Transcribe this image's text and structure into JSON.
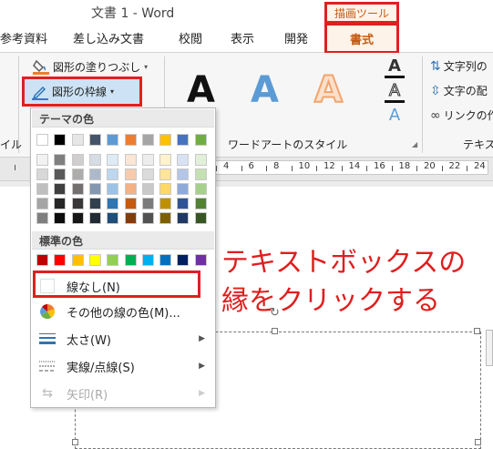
{
  "window": {
    "title": "文書 1 - Word"
  },
  "context_tab": {
    "label": "描画ツール"
  },
  "tabs": [
    {
      "label": "参考資料"
    },
    {
      "label": "差し込み文書"
    },
    {
      "label": "校閲"
    },
    {
      "label": "表示"
    },
    {
      "label": "開発"
    },
    {
      "label": "書式"
    }
  ],
  "ribbon": {
    "shape_fill": "図形の塗りつぶし",
    "shape_outline": "図形の枠線",
    "left_group_partial": "イル",
    "wordart_styles": "ワードアートのスタイル",
    "text_direction": "文字列の",
    "text_align": "文字の配",
    "create_link": "リンクの作",
    "text_group_partial": "テキス",
    "wordart_sample": "A"
  },
  "ruler": {
    "numbers": [
      "4",
      "6",
      "8",
      "10",
      "12",
      "14",
      "16",
      "18",
      "20",
      "22",
      "24"
    ]
  },
  "menu": {
    "theme_colors_label": "テーマの色",
    "standard_colors_label": "標準の色",
    "no_outline": "線なし(N)",
    "more_colors": "その他の線の色(M)...",
    "weight": "太さ(W)",
    "dashes": "実線/点線(S)",
    "arrows": "矢印(R)",
    "theme_top": [
      "#ffffff",
      "#000000",
      "#e7e6e6",
      "#44546a",
      "#5b9bd5",
      "#ed7d31",
      "#a5a5a5",
      "#ffc000",
      "#4472c4",
      "#70ad47"
    ],
    "theme_shades": [
      [
        "#f2f2f2",
        "#7f7f7f",
        "#d0cece",
        "#d6dce4",
        "#deebf6",
        "#fbe5d5",
        "#ededed",
        "#fff2cc",
        "#d9e2f3",
        "#e2efd9"
      ],
      [
        "#d8d8d8",
        "#595959",
        "#aeabab",
        "#adb9ca",
        "#bdd7ee",
        "#f7cbac",
        "#dbdbdb",
        "#fee599",
        "#b4c6e7",
        "#c5e0b3"
      ],
      [
        "#bfbfbf",
        "#3f3f3f",
        "#757070",
        "#8497b0",
        "#9cc3e5",
        "#f4b183",
        "#c9c9c9",
        "#ffd965",
        "#8eaadb",
        "#a8d08d"
      ],
      [
        "#a5a5a5",
        "#262626",
        "#3a3838",
        "#323f4f",
        "#2e75b5",
        "#c55a11",
        "#7b7b7b",
        "#bf9000",
        "#2f5496",
        "#538135"
      ],
      [
        "#7f7f7f",
        "#0c0c0c",
        "#171616",
        "#222a35",
        "#1e4e79",
        "#843c0b",
        "#525252",
        "#7f6000",
        "#1f3864",
        "#375623"
      ]
    ],
    "standard": [
      "#c00000",
      "#ff0000",
      "#ffc000",
      "#ffff00",
      "#92d050",
      "#00b050",
      "#00b0f0",
      "#0070c0",
      "#002060",
      "#7030a0"
    ]
  },
  "annotation": {
    "line1": "テキストボックスの",
    "line2": "縁をクリックする"
  },
  "colors": {
    "highlight": "#e02020",
    "accent": "#c55a11"
  }
}
